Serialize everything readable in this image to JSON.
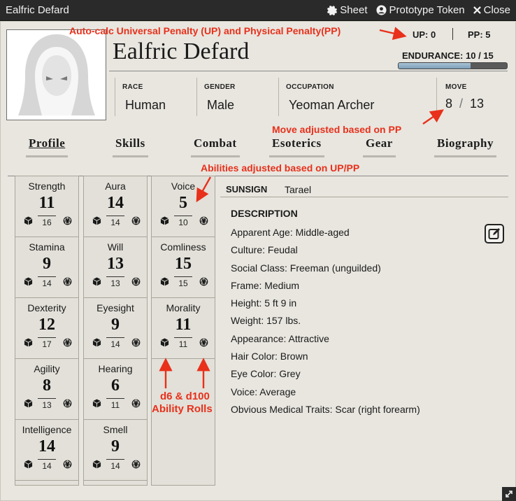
{
  "window": {
    "title": "Ealfric Defard",
    "sheet_label": "Sheet",
    "token_label": "Prototype Token",
    "close_label": "Close"
  },
  "character": {
    "name": "Ealfric Defard",
    "up_text": "UP: 0",
    "pp_text": "PP: 5",
    "endurance_text": "ENDURANCE: 10 / 15",
    "endurance_fraction": 0.667
  },
  "info": {
    "race": {
      "label": "RACE",
      "value": "Human"
    },
    "gender": {
      "label": "GENDER",
      "value": "Male"
    },
    "occupation": {
      "label": "OCCUPATION",
      "value": "Yeoman Archer"
    },
    "move": {
      "label": "MOVE",
      "current": "8",
      "slash": "/",
      "max": "13"
    }
  },
  "tabs": [
    {
      "label": "Profile",
      "active": true
    },
    {
      "label": "Skills"
    },
    {
      "label": "Combat"
    },
    {
      "label": "Esoterics"
    },
    {
      "label": "Gear"
    },
    {
      "label": "Biography"
    }
  ],
  "abilities": {
    "col1": [
      {
        "name": "Strength",
        "value": "11",
        "max": "16"
      },
      {
        "name": "Stamina",
        "value": "9",
        "max": "14"
      },
      {
        "name": "Dexterity",
        "value": "12",
        "max": "17"
      },
      {
        "name": "Agility",
        "value": "8",
        "max": "13"
      },
      {
        "name": "Intelligence",
        "value": "14",
        "max": "14"
      }
    ],
    "col2": [
      {
        "name": "Aura",
        "value": "14",
        "max": "14"
      },
      {
        "name": "Will",
        "value": "13",
        "max": "13"
      },
      {
        "name": "Eyesight",
        "value": "9",
        "max": "14"
      },
      {
        "name": "Hearing",
        "value": "6",
        "max": "11"
      },
      {
        "name": "Smell",
        "value": "9",
        "max": "14"
      }
    ],
    "col3": [
      {
        "name": "Voice",
        "value": "5",
        "max": "10"
      },
      {
        "name": "Comliness",
        "value": "15",
        "max": "15"
      },
      {
        "name": "Morality",
        "value": "11",
        "max": "11"
      }
    ]
  },
  "sunsign": {
    "label": "SUNSIGN",
    "value": "Tarael"
  },
  "description": {
    "heading": "DESCRIPTION",
    "items": [
      "Apparent Age: Middle-aged",
      "Culture: Feudal",
      "Social Class: Freeman (unguilded)",
      "Frame: Medium",
      "Height: 5 ft 9 in",
      "Weight: 157 lbs.",
      "Appearance: Attractive",
      "Hair Color: Brown",
      "Eye Color: Grey",
      "Voice: Average",
      "Obvious Medical Traits: Scar (right forearm)"
    ]
  },
  "annotations": {
    "up_pp": "Auto-calc Universal Penalty (UP) and Physical Penalty(PP)",
    "move": "Move adjusted based on PP",
    "abilities": "Abilities adjusted based on UP/PP",
    "rolls_line1": "d6 & d100",
    "rolls_line2": "Ability Rolls"
  },
  "colors": {
    "annotation": "#e8301b",
    "background": "#e8e6df",
    "titlebar": "#2a2a2a"
  }
}
